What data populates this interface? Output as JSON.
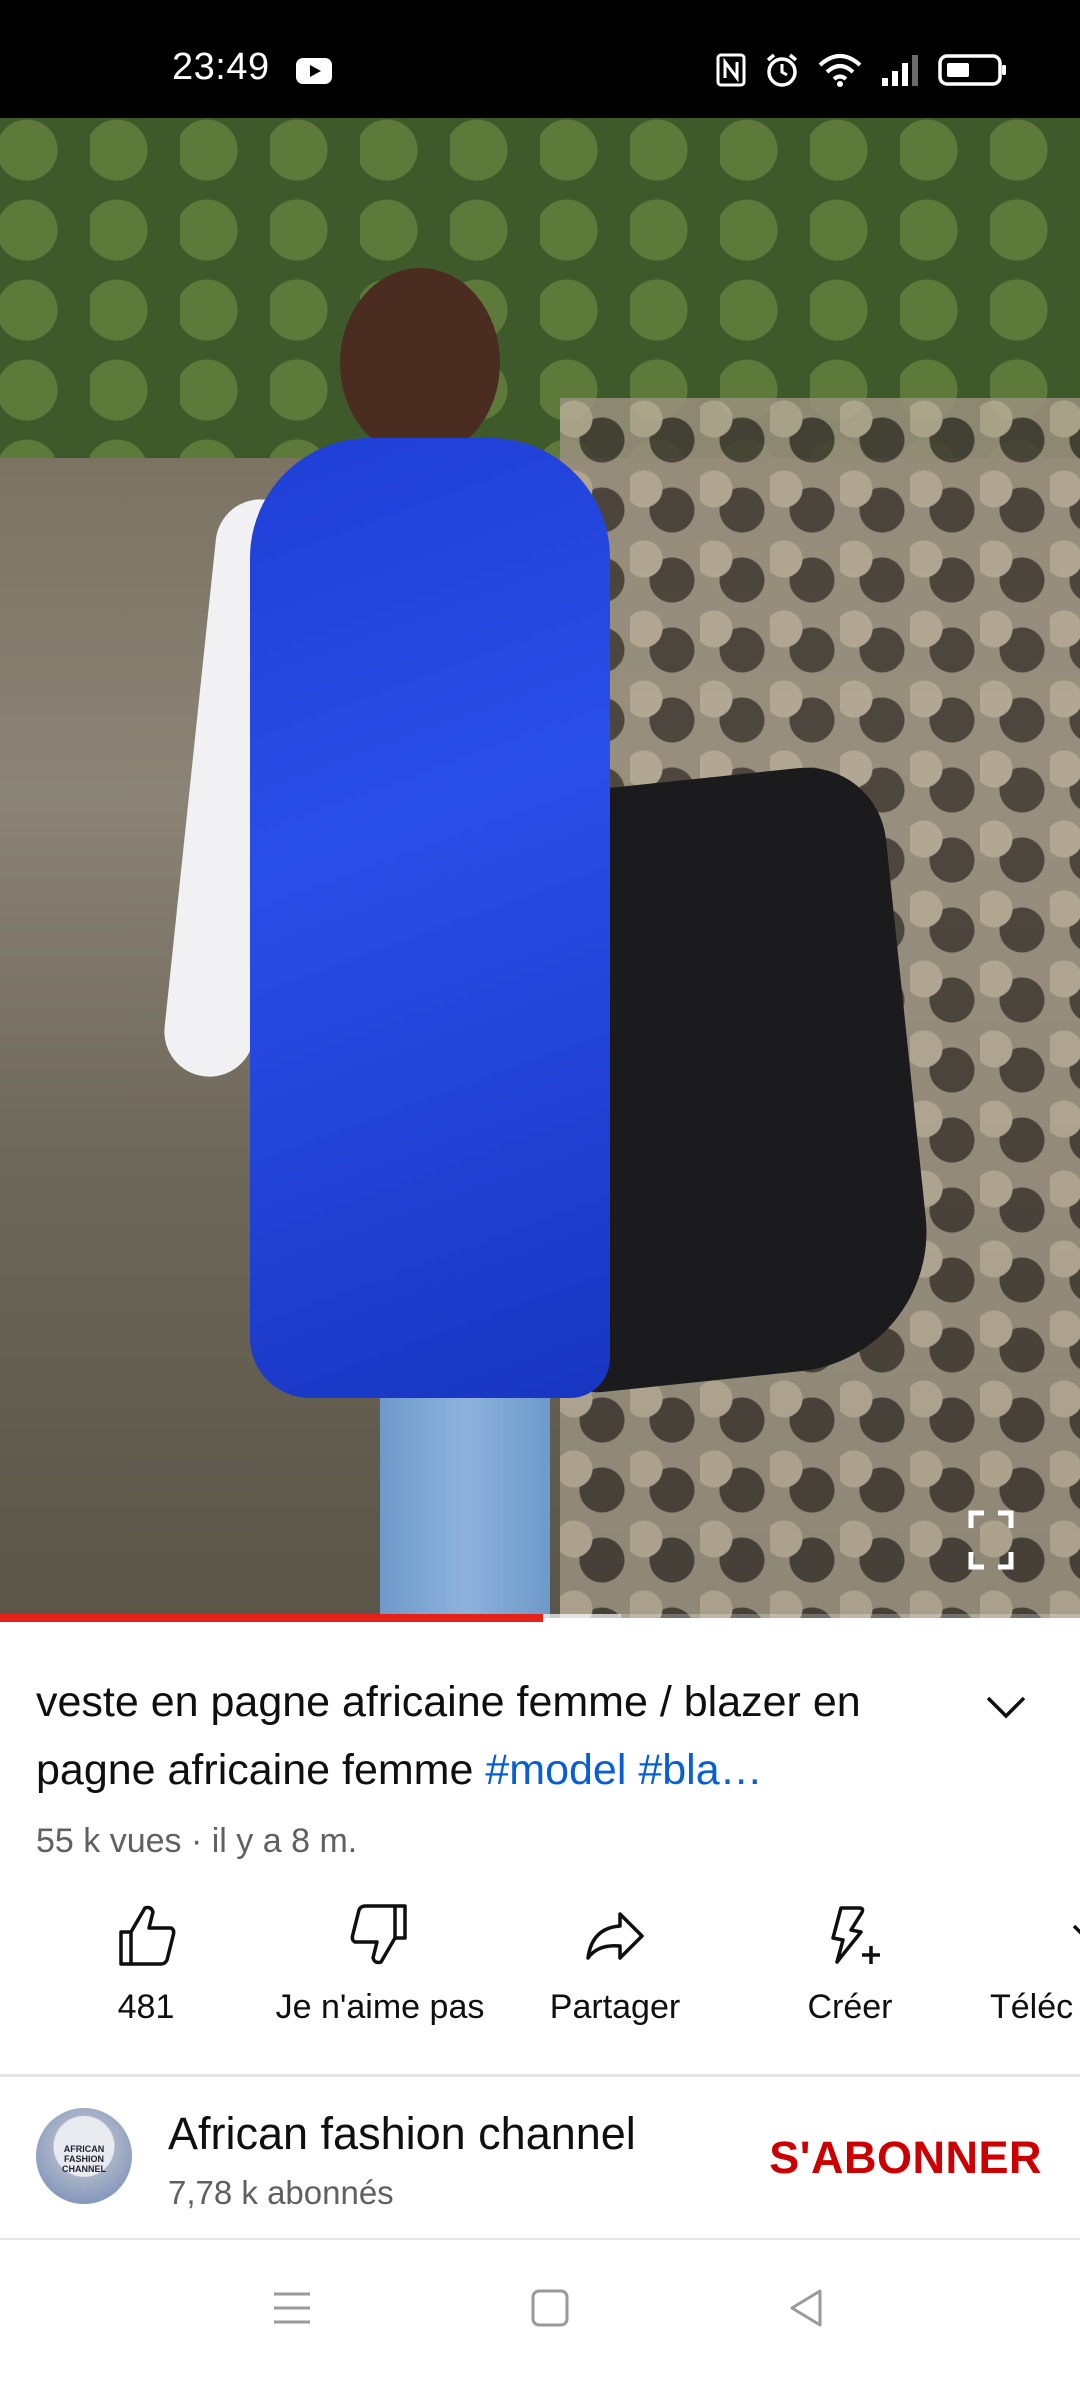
{
  "status_bar": {
    "time": "23:49",
    "icons": [
      "youtube-notification-icon",
      "nfc-icon",
      "alarm-icon",
      "wifi-icon",
      "signal-icon",
      "battery-icon"
    ]
  },
  "video": {
    "progress_fraction": 0.503,
    "buffered_fraction": 0.575,
    "accent_color": "#e62117"
  },
  "title": {
    "text": "veste en pagne africaine femme / blazer en pagne africaine femme ",
    "hashtags": "#model #bla…"
  },
  "meta": "55 k vues · il y a 8 m.",
  "actions": [
    {
      "name": "like",
      "label": "481"
    },
    {
      "name": "dislike",
      "label": "Je n'aime pas"
    },
    {
      "name": "share",
      "label": "Partager"
    },
    {
      "name": "create",
      "label": "Créer"
    },
    {
      "name": "download",
      "label": "Téléc"
    }
  ],
  "channel": {
    "name": "African fashion channel",
    "subscribers": "7,78 k abonnés",
    "subscribe_label": "S'ABONNER",
    "avatar_text": "AFRICAN FASHION CHANNEL"
  },
  "navbar": {
    "icons": [
      "menu-icon",
      "home-square-icon",
      "back-triangle-icon"
    ]
  }
}
